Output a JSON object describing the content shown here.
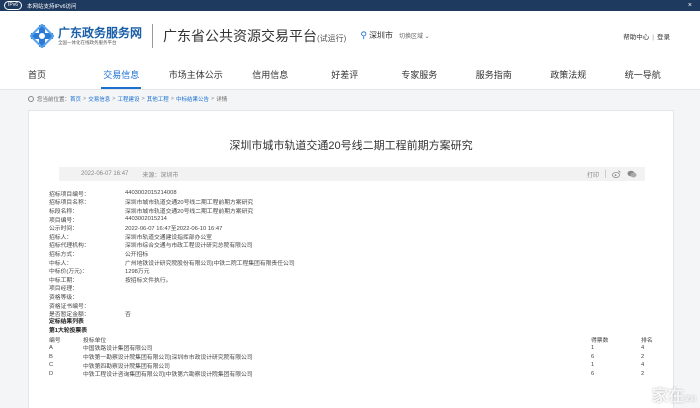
{
  "ipv6_bar": {
    "badge": "IPv6",
    "text": "本网站支持IPv6访问",
    "close": "×"
  },
  "header": {
    "logo_main": "广东政务服务网",
    "logo_sub": "全国一体化在线政务服务平台",
    "platform_title": "广东省公共资源交易平台",
    "platform_suffix": "(试运行)",
    "city": "深圳市",
    "switch_label": "切换区域",
    "help": "帮助中心",
    "sep": "|",
    "login": "登录"
  },
  "nav": [
    {
      "label": "首页"
    },
    {
      "label": "交易信息"
    },
    {
      "label": "市场主体公示"
    },
    {
      "label": "信用信息"
    },
    {
      "label": "好差评"
    },
    {
      "label": "专家服务"
    },
    {
      "label": "服务指南"
    },
    {
      "label": "政策法规"
    },
    {
      "label": "统一导航"
    }
  ],
  "breadcrumb": {
    "prefix": "您当前位置：",
    "items": [
      "首页",
      "交易信息",
      "工程建设",
      "其他工程",
      "中标结果公告",
      "详情"
    ],
    "sep": ">"
  },
  "article": {
    "title": "深圳市城市轨道交通20号线二期工程前期方案研究",
    "date": "2022-06-07 16:47",
    "source": "来源：深圳市",
    "print": "打印",
    "fields": [
      {
        "label": "招标项目编号：",
        "value": "4403002015214008"
      },
      {
        "label": "招标项目名称：",
        "value": "深圳市城市轨道交通20号线二期工程前期方案研究"
      },
      {
        "label": "标段名称：",
        "value": "深圳市城市轨道交通20号线二期工程前期方案研究"
      },
      {
        "label": "项目编号：",
        "value": "4403002015214"
      },
      {
        "label": "公示时间：",
        "value": "2022-06-07 16:47至2022-06-10 16:47"
      },
      {
        "label": "招标人：",
        "value": "深圳市轨道交通建设指挥部办公室"
      },
      {
        "label": "招标代理机构：",
        "value": "深圳市综合交通与市政工程设计研究总院有限公司"
      },
      {
        "label": "招标方式：",
        "value": "公开招标"
      },
      {
        "label": "中标人：",
        "value": "广州地铁设计研究院股份有限公司|中铁二院工程集团有限责任公司"
      },
      {
        "label": "中标价(万元)：",
        "value": "1298万元"
      },
      {
        "label": "中标工期：",
        "value": "按招标文件执行。"
      },
      {
        "label": "项目经理：",
        "value": ""
      },
      {
        "label": "资格等级：",
        "value": ""
      },
      {
        "label": "资格证书编号：",
        "value": ""
      },
      {
        "label": "是否暂定金额：",
        "value": "否"
      }
    ],
    "section1": "定标结果列表",
    "section2": "第1大轮投票表",
    "table_header": {
      "c1": "编号",
      "c2": "投标单位",
      "c3": "得票数",
      "c4": "排名"
    },
    "table_rows": [
      {
        "c1": "A",
        "c2": "中国铁路设计集团有限公司",
        "c3": "1",
        "c4": "4"
      },
      {
        "c1": "B",
        "c2": "中铁第一勘察设计院集团有限公司|深圳市市政设计研究院有限公司",
        "c3": "6",
        "c4": "2"
      },
      {
        "c1": "C",
        "c2": "中铁第四勘察设计院集团有限公司",
        "c3": "1",
        "c4": "4"
      },
      {
        "c1": "D",
        "c2": "中铁工程设计咨询集团有限公司|中铁第六勘察设计院集团有限公司",
        "c3": "6",
        "c4": "2"
      }
    ]
  },
  "watermark": {
    "text": "家在",
    "sub": "深圳"
  },
  "colors": {
    "accent": "#1a6fd1",
    "ipv6_bar": "#1f3a5f"
  }
}
